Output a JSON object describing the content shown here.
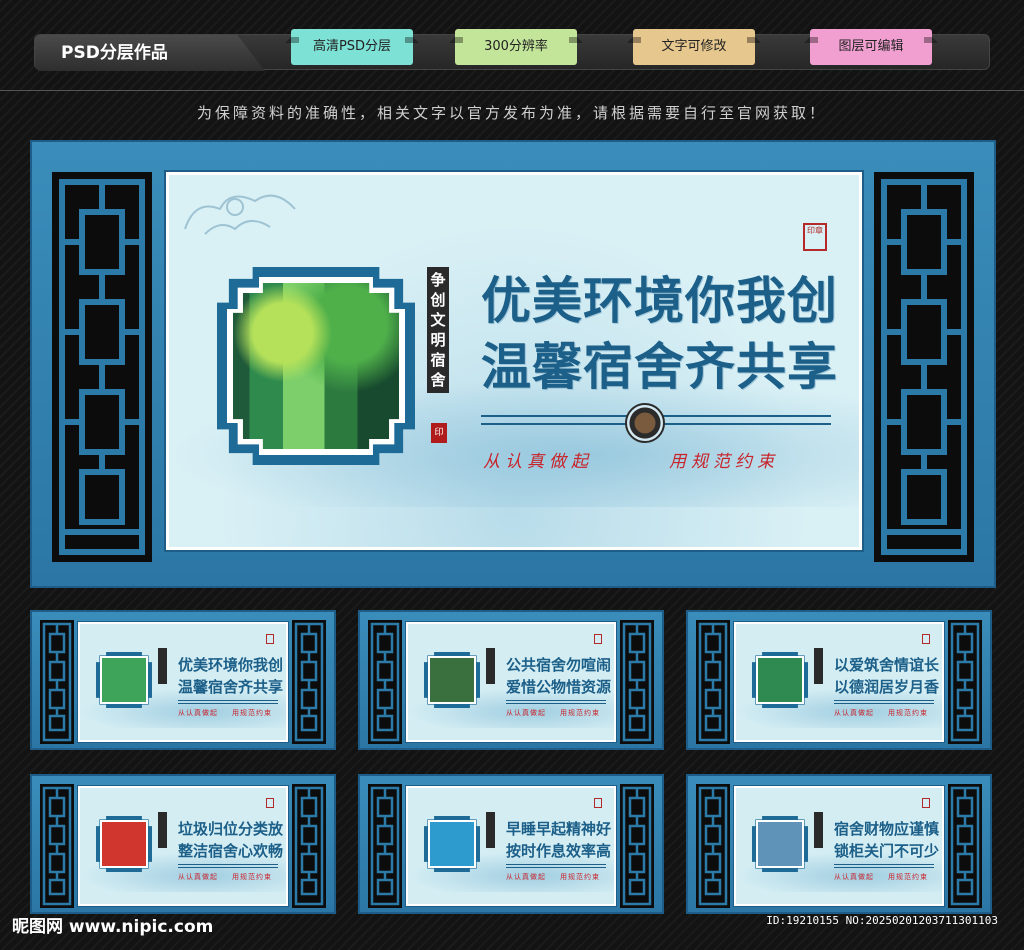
{
  "header": {
    "brand": "PSD分层作品",
    "tags": [
      "高清PSD分层",
      "300分辨率",
      "文字可修改",
      "图层可编辑"
    ]
  },
  "notice": "为保障资料的准确性，相关文字以官方发布为准，请根据需要自行至官网获取！",
  "main": {
    "vertical_tag": "争创文明宿舍",
    "headline_1": "优美环境你我创",
    "headline_2": "温馨宿舍齐共享",
    "slogan_left": "从认真做起",
    "slogan_right": "用规范约束",
    "photo_icon": "forest-photo"
  },
  "thumbnails": [
    {
      "line1": "优美环境你我创",
      "line2": "温馨宿舍齐共享",
      "photo_color": "#3ea45a",
      "photo_icon": "forest-photo"
    },
    {
      "line1": "公共宿舍勿喧闹",
      "line2": "爱惜公物惜资源",
      "photo_color": "#3a6f3e",
      "photo_icon": "pavilion-photo"
    },
    {
      "line1": "以爱筑舍情谊长",
      "line2": "以德润居岁月香",
      "photo_color": "#2f8a52",
      "photo_icon": "lotus-photo"
    },
    {
      "line1": "垃圾归位分类放",
      "line2": "整洁宿舍心欢畅",
      "photo_color": "#d0352e",
      "photo_icon": "tulip-photo"
    },
    {
      "line1": "早睡早起精神好",
      "line2": "按时作息效率高",
      "photo_color": "#2e9bcf",
      "photo_icon": "dandelion-photo"
    },
    {
      "line1": "宿舍财物应谨慎",
      "line2": "锁柜关门不可少",
      "photo_color": "#5f93b8",
      "photo_icon": "ding-photo"
    }
  ],
  "footer": {
    "logo": "昵图网 www.nipic.com",
    "id_text": "ID:19210155 NO:20250201203711301103"
  }
}
